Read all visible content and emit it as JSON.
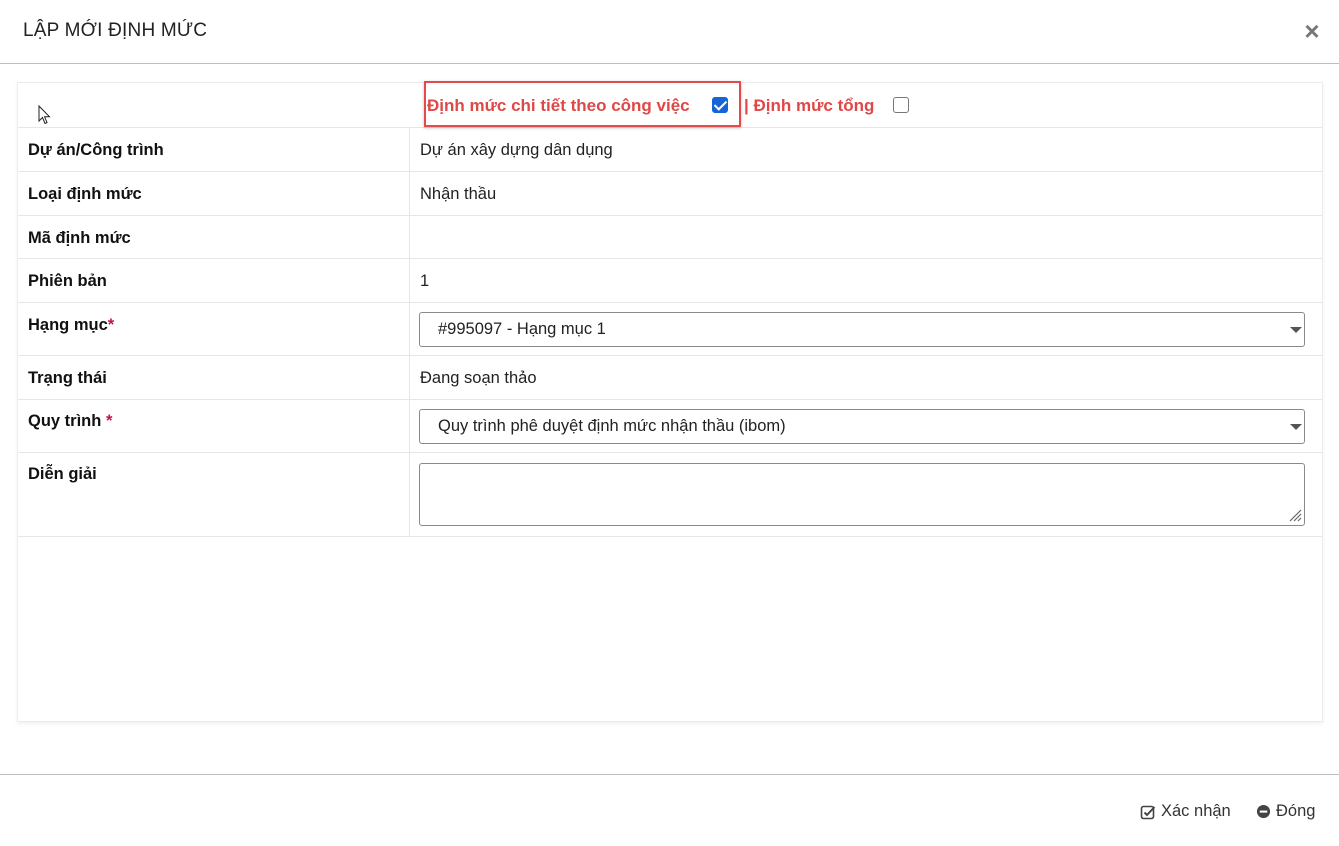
{
  "modal": {
    "title": "LẬP MỚI ĐỊNH MỨC",
    "close_symbol": "×"
  },
  "mode": {
    "detail_label": "Định mức chi tiết theo công việc",
    "detail_checked": true,
    "total_label": "| Định mức tổng",
    "total_checked": false
  },
  "form": {
    "project_label": "Dự án/Công trình",
    "project_value": "Dự án xây dựng dân dụng",
    "type_label": "Loại định mức",
    "type_value": "Nhận thầu",
    "code_label": "Mã định mức",
    "code_value": "",
    "version_label": "Phiên bản",
    "version_value": "1",
    "category_label": "Hạng mục",
    "category_required": "*",
    "category_selected": "#995097 - Hạng mục 1",
    "status_label": "Trạng thái",
    "status_value": "Đang soạn thảo",
    "process_label": "Quy trình",
    "process_required": "*",
    "process_selected": "Quy trình phê duyệt định mức nhận thầu (ibom)",
    "description_label": "Diễn giải",
    "description_value": ""
  },
  "footer": {
    "confirm_label": "Xác nhận",
    "close_label": "Đóng"
  },
  "icons": {
    "close": "close-icon",
    "confirm": "check-square-icon",
    "dismiss": "minus-circle-icon",
    "dropdown": "caret-down-icon"
  },
  "colors": {
    "mode_text": "#e04848",
    "required": "#c0134a",
    "checkbox": "#1565d8"
  }
}
